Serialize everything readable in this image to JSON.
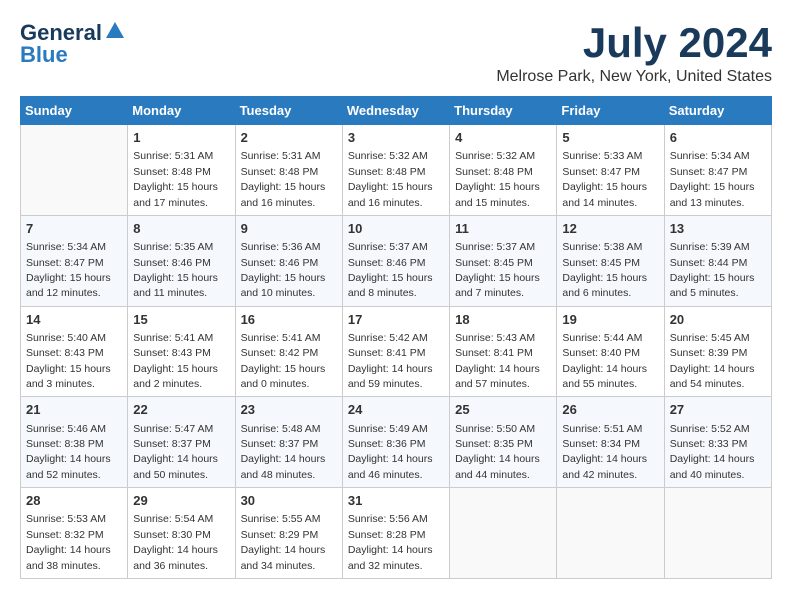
{
  "logo": {
    "line1": "General",
    "line2": "Blue"
  },
  "header": {
    "month": "July 2024",
    "location": "Melrose Park, New York, United States"
  },
  "days_of_week": [
    "Sunday",
    "Monday",
    "Tuesday",
    "Wednesday",
    "Thursday",
    "Friday",
    "Saturday"
  ],
  "weeks": [
    [
      {
        "day": "",
        "info": ""
      },
      {
        "day": "1",
        "info": "Sunrise: 5:31 AM\nSunset: 8:48 PM\nDaylight: 15 hours\nand 17 minutes."
      },
      {
        "day": "2",
        "info": "Sunrise: 5:31 AM\nSunset: 8:48 PM\nDaylight: 15 hours\nand 16 minutes."
      },
      {
        "day": "3",
        "info": "Sunrise: 5:32 AM\nSunset: 8:48 PM\nDaylight: 15 hours\nand 16 minutes."
      },
      {
        "day": "4",
        "info": "Sunrise: 5:32 AM\nSunset: 8:48 PM\nDaylight: 15 hours\nand 15 minutes."
      },
      {
        "day": "5",
        "info": "Sunrise: 5:33 AM\nSunset: 8:47 PM\nDaylight: 15 hours\nand 14 minutes."
      },
      {
        "day": "6",
        "info": "Sunrise: 5:34 AM\nSunset: 8:47 PM\nDaylight: 15 hours\nand 13 minutes."
      }
    ],
    [
      {
        "day": "7",
        "info": "Sunrise: 5:34 AM\nSunset: 8:47 PM\nDaylight: 15 hours\nand 12 minutes."
      },
      {
        "day": "8",
        "info": "Sunrise: 5:35 AM\nSunset: 8:46 PM\nDaylight: 15 hours\nand 11 minutes."
      },
      {
        "day": "9",
        "info": "Sunrise: 5:36 AM\nSunset: 8:46 PM\nDaylight: 15 hours\nand 10 minutes."
      },
      {
        "day": "10",
        "info": "Sunrise: 5:37 AM\nSunset: 8:46 PM\nDaylight: 15 hours\nand 8 minutes."
      },
      {
        "day": "11",
        "info": "Sunrise: 5:37 AM\nSunset: 8:45 PM\nDaylight: 15 hours\nand 7 minutes."
      },
      {
        "day": "12",
        "info": "Sunrise: 5:38 AM\nSunset: 8:45 PM\nDaylight: 15 hours\nand 6 minutes."
      },
      {
        "day": "13",
        "info": "Sunrise: 5:39 AM\nSunset: 8:44 PM\nDaylight: 15 hours\nand 5 minutes."
      }
    ],
    [
      {
        "day": "14",
        "info": "Sunrise: 5:40 AM\nSunset: 8:43 PM\nDaylight: 15 hours\nand 3 minutes."
      },
      {
        "day": "15",
        "info": "Sunrise: 5:41 AM\nSunset: 8:43 PM\nDaylight: 15 hours\nand 2 minutes."
      },
      {
        "day": "16",
        "info": "Sunrise: 5:41 AM\nSunset: 8:42 PM\nDaylight: 15 hours\nand 0 minutes."
      },
      {
        "day": "17",
        "info": "Sunrise: 5:42 AM\nSunset: 8:41 PM\nDaylight: 14 hours\nand 59 minutes."
      },
      {
        "day": "18",
        "info": "Sunrise: 5:43 AM\nSunset: 8:41 PM\nDaylight: 14 hours\nand 57 minutes."
      },
      {
        "day": "19",
        "info": "Sunrise: 5:44 AM\nSunset: 8:40 PM\nDaylight: 14 hours\nand 55 minutes."
      },
      {
        "day": "20",
        "info": "Sunrise: 5:45 AM\nSunset: 8:39 PM\nDaylight: 14 hours\nand 54 minutes."
      }
    ],
    [
      {
        "day": "21",
        "info": "Sunrise: 5:46 AM\nSunset: 8:38 PM\nDaylight: 14 hours\nand 52 minutes."
      },
      {
        "day": "22",
        "info": "Sunrise: 5:47 AM\nSunset: 8:37 PM\nDaylight: 14 hours\nand 50 minutes."
      },
      {
        "day": "23",
        "info": "Sunrise: 5:48 AM\nSunset: 8:37 PM\nDaylight: 14 hours\nand 48 minutes."
      },
      {
        "day": "24",
        "info": "Sunrise: 5:49 AM\nSunset: 8:36 PM\nDaylight: 14 hours\nand 46 minutes."
      },
      {
        "day": "25",
        "info": "Sunrise: 5:50 AM\nSunset: 8:35 PM\nDaylight: 14 hours\nand 44 minutes."
      },
      {
        "day": "26",
        "info": "Sunrise: 5:51 AM\nSunset: 8:34 PM\nDaylight: 14 hours\nand 42 minutes."
      },
      {
        "day": "27",
        "info": "Sunrise: 5:52 AM\nSunset: 8:33 PM\nDaylight: 14 hours\nand 40 minutes."
      }
    ],
    [
      {
        "day": "28",
        "info": "Sunrise: 5:53 AM\nSunset: 8:32 PM\nDaylight: 14 hours\nand 38 minutes."
      },
      {
        "day": "29",
        "info": "Sunrise: 5:54 AM\nSunset: 8:30 PM\nDaylight: 14 hours\nand 36 minutes."
      },
      {
        "day": "30",
        "info": "Sunrise: 5:55 AM\nSunset: 8:29 PM\nDaylight: 14 hours\nand 34 minutes."
      },
      {
        "day": "31",
        "info": "Sunrise: 5:56 AM\nSunset: 8:28 PM\nDaylight: 14 hours\nand 32 minutes."
      },
      {
        "day": "",
        "info": ""
      },
      {
        "day": "",
        "info": ""
      },
      {
        "day": "",
        "info": ""
      }
    ]
  ]
}
